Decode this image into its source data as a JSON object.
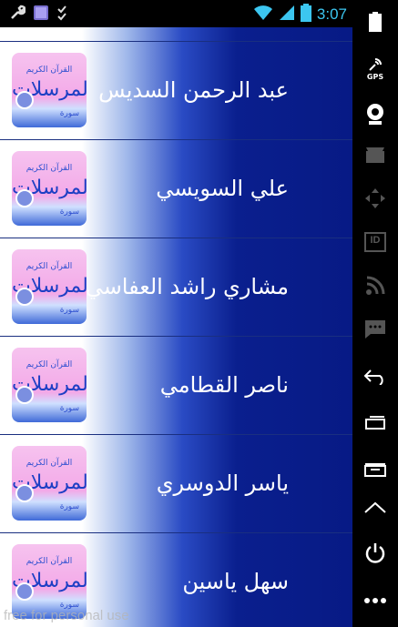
{
  "status_bar": {
    "time": "3:07"
  },
  "reciters": [
    {
      "name": "عبد الرحمن السديس"
    },
    {
      "name": "علي السويسي"
    },
    {
      "name": "مشاري راشد العفاسي"
    },
    {
      "name": "ناصر القطامي"
    },
    {
      "name": "ياسر الدوسري"
    },
    {
      "name": "سهل ياسين"
    }
  ],
  "thumbnail": {
    "top_text": "القرآن الكريم",
    "main_text": "المرسلات",
    "bottom_text": "سورة"
  },
  "watermark": "free for personal use",
  "side_nav": {
    "icons": [
      "battery-icon",
      "gps-icon",
      "webcam-icon",
      "video-icon",
      "dpad-icon",
      "id-icon",
      "rss-icon",
      "sms-icon",
      "back-icon",
      "home-icon",
      "recent-apps-icon",
      "menu-icon",
      "power-icon",
      "more-icon"
    ],
    "gps_label": "GPS",
    "id_label": "ID"
  }
}
